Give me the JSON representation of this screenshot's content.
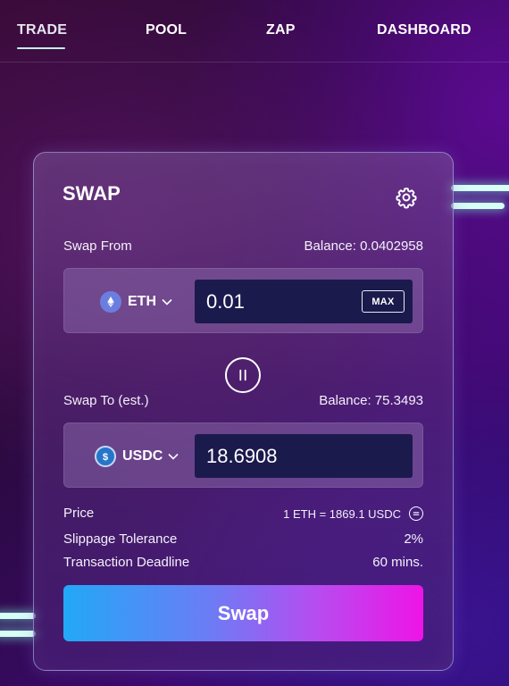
{
  "nav": {
    "items": [
      {
        "label": "TRADE",
        "active": true
      },
      {
        "label": "POOL",
        "active": false
      },
      {
        "label": "ZAP",
        "active": false
      },
      {
        "label": "DASHBOARD",
        "active": false
      }
    ]
  },
  "swap": {
    "title": "SWAP",
    "settings_icon": "gear-icon",
    "from": {
      "label": "Swap From",
      "balance": "Balance: 0.0402958",
      "token": "ETH",
      "token_icon": "ethereum-icon",
      "amount": "0.01",
      "max_label": "MAX"
    },
    "switch_icon": "swap-direction-icon",
    "to": {
      "label": "Swap To (est.)",
      "balance": "Balance: 75.3493",
      "token": "USDC",
      "token_icon": "usdc-icon",
      "amount": "18.6908"
    },
    "details": {
      "price_label": "Price",
      "price_value": "1 ETH = 1869.1 USDC",
      "slippage_label": "Slippage Tolerance",
      "slippage_value": "2%",
      "deadline_label": "Transaction Deadline",
      "deadline_value": "60 mins."
    },
    "submit_label": "Swap"
  },
  "colors": {
    "accent_start": "#22a8f7",
    "accent_end": "#ee14e6",
    "input_bg": "#1b1a4d",
    "glow": "#d6fff5"
  }
}
